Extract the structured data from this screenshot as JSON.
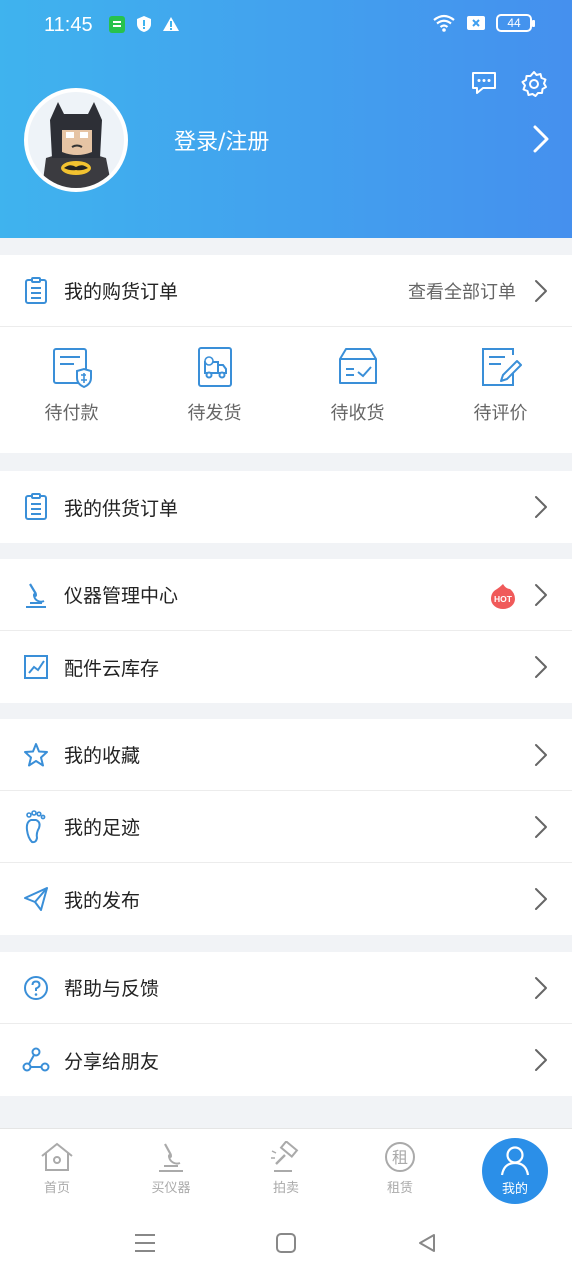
{
  "status_bar": {
    "time": "11:45",
    "battery": "44"
  },
  "header": {
    "login_label": "登录/注册"
  },
  "purchase_orders": {
    "title": "我的购货订单",
    "view_all": "查看全部订单",
    "statuses": [
      {
        "label": "待付款",
        "icon": "pending-payment-icon"
      },
      {
        "label": "待发货",
        "icon": "pending-shipment-icon"
      },
      {
        "label": "待收货",
        "icon": "pending-receipt-icon"
      },
      {
        "label": "待评价",
        "icon": "pending-review-icon"
      }
    ]
  },
  "supply_orders": {
    "title": "我的供货订单"
  },
  "instrument_group": {
    "items": [
      {
        "label": "仪器管理中心",
        "badge": "HOT"
      },
      {
        "label": "配件云库存"
      }
    ]
  },
  "personal_group": {
    "items": [
      {
        "label": "我的收藏"
      },
      {
        "label": "我的足迹"
      },
      {
        "label": "我的发布"
      }
    ]
  },
  "support_group": {
    "items": [
      {
        "label": "帮助与反馈"
      },
      {
        "label": "分享给朋友"
      }
    ]
  },
  "tabbar": {
    "tabs": [
      {
        "label": "首页"
      },
      {
        "label": "买仪器"
      },
      {
        "label": "拍卖"
      },
      {
        "label": "租赁",
        "icon_char": "租"
      },
      {
        "label": "我的"
      }
    ]
  },
  "colors": {
    "accent": "#2b8fe8",
    "header_start": "#3fb3ee",
    "header_end": "#4590ee",
    "icon_blue": "#3a8fd8",
    "hot_red": "#f05a5a"
  }
}
